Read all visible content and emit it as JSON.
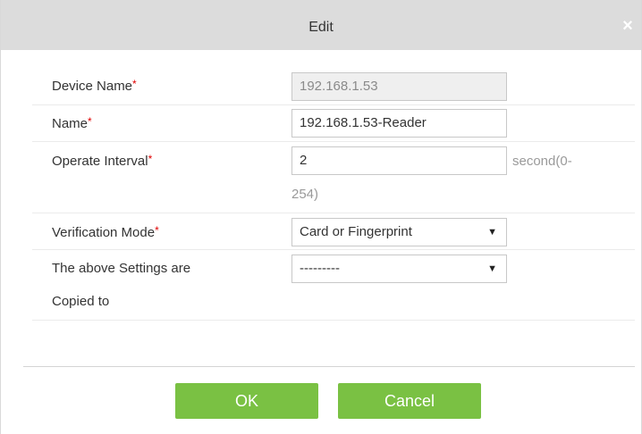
{
  "dialog": {
    "title": "Edit",
    "close_glyph": "×"
  },
  "form": {
    "device_name": {
      "label": "Device Name",
      "required_mark": "*",
      "value": "192.168.1.53"
    },
    "name": {
      "label": "Name",
      "required_mark": "*",
      "value": "192.168.1.53-Reader"
    },
    "operate_interval": {
      "label": "Operate Interval",
      "required_mark": "*",
      "value": "2",
      "hint_line1": "second(0-",
      "hint_line2": "254)"
    },
    "verification_mode": {
      "label": "Verification Mode",
      "required_mark": "*",
      "selected": "Card or Fingerprint"
    },
    "copy_to": {
      "label_line1": "The above Settings are",
      "label_line2": "Copied to",
      "selected": "---------"
    }
  },
  "buttons": {
    "ok": "OK",
    "cancel": "Cancel"
  },
  "icons": {
    "close": "close-icon",
    "dropdown": "chevron-down-icon"
  },
  "colors": {
    "accent_button": "#7ac143",
    "required": "#e00000",
    "titlebar": "#dcdcdc"
  }
}
